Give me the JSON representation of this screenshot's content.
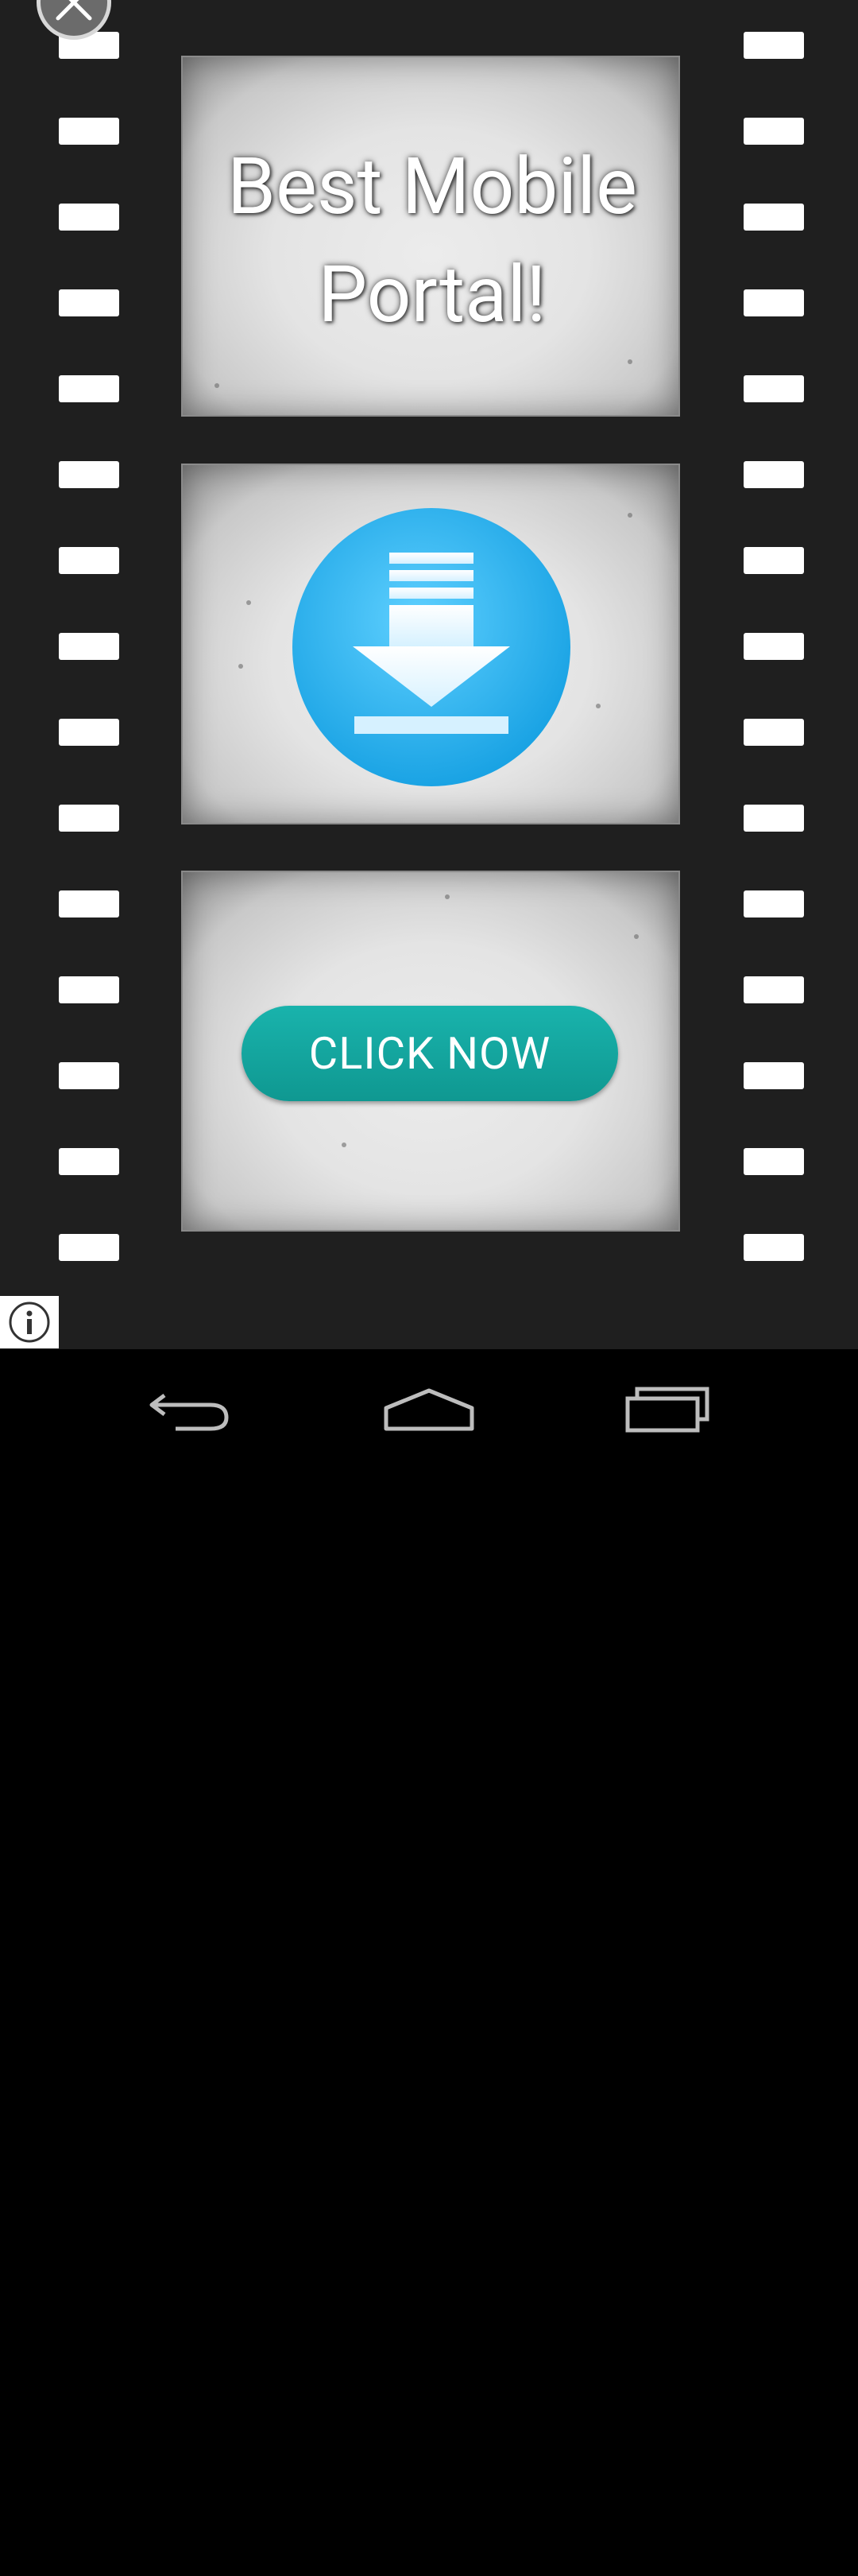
{
  "ad": {
    "headline": "Best Mobile\nPortal!",
    "cta_label": "CLICK NOW",
    "colors": {
      "film_background": "#1f1f1f",
      "cta_button": "#13a59e",
      "download_circle": "#36b6ef"
    },
    "icons": {
      "close": "close-icon",
      "download": "download-icon",
      "info": "info-icon"
    }
  },
  "nav_bar": {
    "icons": [
      "back-icon",
      "home-icon",
      "recent-apps-icon"
    ]
  }
}
